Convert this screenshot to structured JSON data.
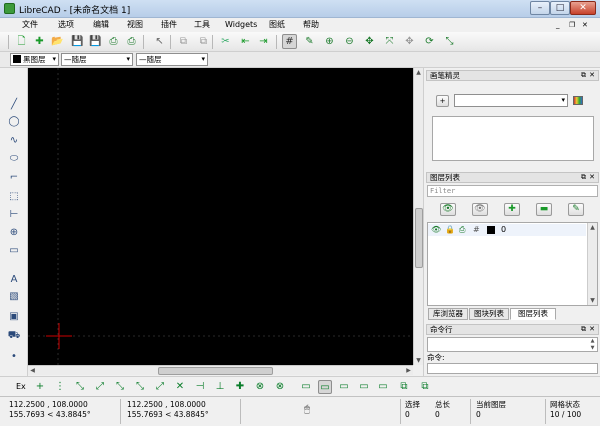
{
  "window": {
    "title": "LibreCAD - [未命名文档 1]",
    "min": "–",
    "max": "□",
    "close": "✕"
  },
  "menu": [
    "文件",
    "选项",
    "编辑",
    "视图",
    "插件",
    "工具",
    "Widgets",
    "图纸",
    "帮助"
  ],
  "menu_right": {
    "min": "_",
    "restore": "❐",
    "close": "✕"
  },
  "toolbar1": [
    {
      "name": "new-file-icon",
      "glyph": "🗋",
      "color": "#1a9a2a"
    },
    {
      "name": "new-template-icon",
      "glyph": "✚",
      "color": "#1a9a2a"
    },
    {
      "name": "open-file-icon",
      "glyph": "📂",
      "color": "#1a9a2a"
    },
    {
      "name": "save-icon",
      "glyph": "💾",
      "color": "#1a9a2a"
    },
    {
      "name": "save-as-icon",
      "glyph": "💾",
      "color": "#1a9a2a"
    },
    {
      "name": "print-icon",
      "glyph": "⎙",
      "color": "#1a7a2a"
    },
    {
      "name": "print-preview-icon",
      "glyph": "⎙",
      "color": "#1a7a2a"
    },
    {
      "name": "select-pointer-icon",
      "glyph": "↖",
      "color": "#666"
    },
    {
      "name": "copy-icon",
      "glyph": "⧉",
      "color": "#999"
    },
    {
      "name": "paste-icon",
      "glyph": "⧉",
      "color": "#999"
    },
    {
      "name": "cut-icon",
      "glyph": "✂",
      "color": "#3a6"
    },
    {
      "name": "undo-icon",
      "glyph": "⇤",
      "color": "#1a9a2a"
    },
    {
      "name": "redo-icon",
      "glyph": "⇥",
      "color": "#1a9a2a"
    },
    {
      "name": "grid-toggle-icon",
      "glyph": "#",
      "color": "#333"
    },
    {
      "name": "draft-mode-icon",
      "glyph": "✎",
      "color": "#1a7a2a"
    },
    {
      "name": "zoom-in-icon",
      "glyph": "⊕",
      "color": "#1a7a2a"
    },
    {
      "name": "zoom-out-icon",
      "glyph": "⊖",
      "color": "#1a7a2a"
    },
    {
      "name": "zoom-auto-icon",
      "glyph": "✥",
      "color": "#1a7a2a"
    },
    {
      "name": "zoom-window-icon",
      "glyph": "⤧",
      "color": "#1a7a2a"
    },
    {
      "name": "zoom-pan-icon",
      "glyph": "✥",
      "color": "#999"
    },
    {
      "name": "zoom-redraw-icon",
      "glyph": "⟳",
      "color": "#1a7a2a"
    },
    {
      "name": "zoom-previous-icon",
      "glyph": "⤡",
      "color": "#1a7a2a"
    }
  ],
  "toolbar2": {
    "pen_color": "黑图层",
    "line_type": "随层",
    "line_width": "随层"
  },
  "left_toolbar": [
    {
      "name": "line-tool-icon",
      "glyph": "╱"
    },
    {
      "name": "circle-tool-icon",
      "glyph": "◯"
    },
    {
      "name": "curve-tool-icon",
      "glyph": "∿"
    },
    {
      "name": "ellipse-tool-icon",
      "glyph": "⬭"
    },
    {
      "name": "polyline-tool-icon",
      "glyph": "⌐"
    },
    {
      "name": "select-tool-icon",
      "glyph": "⬚"
    },
    {
      "name": "dimension-tool-icon",
      "glyph": "⊢"
    },
    {
      "name": "modify-tool-icon",
      "glyph": "⊕"
    },
    {
      "name": "measure-tool-icon",
      "glyph": "▭"
    },
    {
      "name": "text-tool-icon",
      "glyph": "A"
    },
    {
      "name": "hatch-tool-icon",
      "glyph": "▧"
    },
    {
      "name": "image-tool-icon",
      "glyph": "▣"
    },
    {
      "name": "block-tool-icon",
      "glyph": "⛟"
    },
    {
      "name": "point-tool-icon",
      "glyph": "•"
    }
  ],
  "right_panel": {
    "pen_wizard": {
      "title": "画笔精灵",
      "combo_value": ""
    },
    "layer_list": {
      "title": "图层列表",
      "filter_placeholder": "Filter",
      "layer_name": "0"
    },
    "tabs": [
      "库浏览器",
      "图块列表",
      "图层列表"
    ],
    "command": {
      "title": "命令行",
      "prompt": "命令:"
    }
  },
  "bottom_toolbar": {
    "label": "Ex",
    "snaps": [
      {
        "name": "snap-free-icon",
        "glyph": "+"
      },
      {
        "name": "snap-grid-icon",
        "glyph": "⋮"
      },
      {
        "name": "snap-endpoint-icon",
        "glyph": "⤡"
      },
      {
        "name": "snap-entity-icon",
        "glyph": "⤢"
      },
      {
        "name": "snap-center-icon",
        "glyph": "⤡"
      },
      {
        "name": "snap-middle-icon",
        "glyph": "⤡"
      },
      {
        "name": "snap-distance-icon",
        "glyph": "⤢"
      },
      {
        "name": "snap-intersection-icon",
        "glyph": "✕"
      },
      {
        "name": "restrict-horizontal-icon",
        "glyph": "⊣"
      },
      {
        "name": "restrict-vertical-icon",
        "glyph": "⊥"
      },
      {
        "name": "restrict-orthogonal-icon",
        "glyph": "✚"
      },
      {
        "name": "relative-zero-icon",
        "glyph": "⊗"
      },
      {
        "name": "lock-relative-zero-icon",
        "glyph": "⊗"
      }
    ],
    "views": [
      {
        "name": "view-screen-icon",
        "glyph": "▭"
      },
      {
        "name": "view-screen-active-icon",
        "glyph": "▭"
      },
      {
        "name": "view-screen-2-icon",
        "glyph": "▭"
      },
      {
        "name": "view-screen-3-icon",
        "glyph": "▭"
      },
      {
        "name": "view-screen-4-icon",
        "glyph": "▭"
      },
      {
        "name": "insert-block-icon",
        "glyph": "⧉"
      },
      {
        "name": "exit-block-icon",
        "glyph": "⧉"
      }
    ]
  },
  "status": {
    "abs_coord": "112.2500 , 108.0000",
    "abs_polar": "155.7693 < 43.8845°",
    "rel_coord": "112.2500 , 108.0000",
    "rel_polar": "155.7693 < 43.8845°",
    "selected_label": "选择",
    "selected_value": "0",
    "total_label": "总长",
    "total_value": "0",
    "layer_label": "当前图层",
    "layer_value": "0",
    "grid_label": "网格状态",
    "grid_value": "10 / 100"
  },
  "colors": {
    "canvas": "#000000",
    "accent": "#1a9a2a",
    "crosshair": "#cc0000"
  }
}
